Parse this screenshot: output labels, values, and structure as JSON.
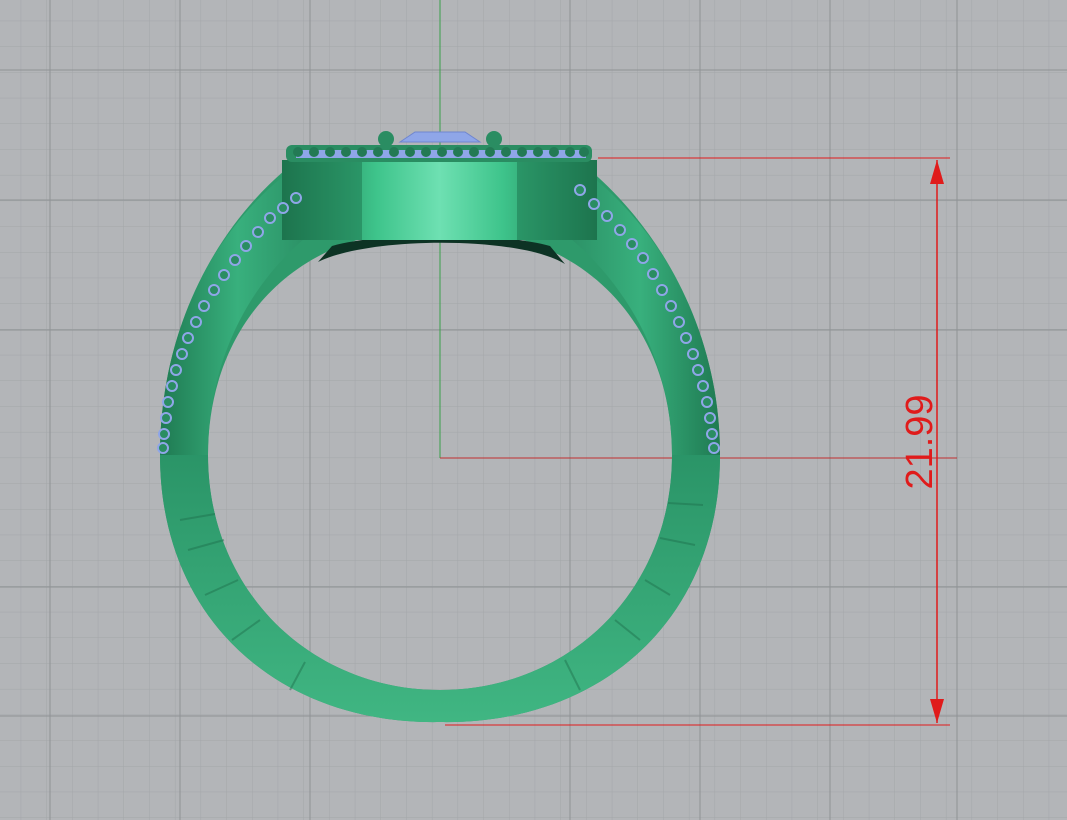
{
  "viewport": {
    "view": "Front",
    "background_color": "#b3b5b8",
    "grid_minor_color": "#a3a6a9",
    "grid_major_color": "#8f9295",
    "axis_y_color": "#3aa04a",
    "axis_x_color": "#c03030"
  },
  "model": {
    "name": "ring",
    "metal_color": "#2f9b6f",
    "metal_highlight": "#5cd4a3",
    "stone_color": "#8fa6e8"
  },
  "dimension": {
    "value": "21.99",
    "color": "#e01b1b"
  }
}
